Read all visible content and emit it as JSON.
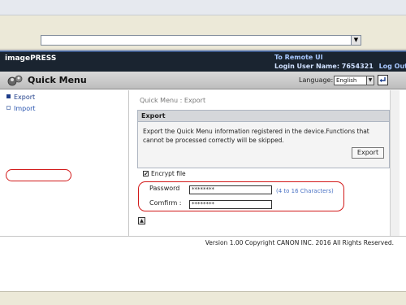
{
  "browser": {
    "address_value": ""
  },
  "header": {
    "brand": "imagePRESS",
    "remote_link": "To Remote UI",
    "login_prefix": "Login User Name: 7654321",
    "logout": "Log Out"
  },
  "titlebar": {
    "title": "Quick Menu",
    "language_label": "Language:",
    "language_value": "English"
  },
  "sidebar": {
    "items": [
      {
        "label": "Export",
        "state": "active"
      },
      {
        "label": "Import",
        "state": "inactive"
      }
    ]
  },
  "main": {
    "breadcrumb": "Quick Menu : Export",
    "export_panel": {
      "heading": "Export",
      "description": "Export the Quick Menu information registered in the device.Functions that cannot be processed correctly will be skipped.",
      "button_label": "Export"
    },
    "encrypt": {
      "checked": true,
      "check_mark": "✔",
      "label": "Encrypt file"
    },
    "password": {
      "label": "Password",
      "value": "********",
      "hint": "(4 to 16 Characters)"
    },
    "confirm": {
      "label": "Comfirm :",
      "value": "********"
    },
    "top_button_symbol": "▲"
  },
  "footer": {
    "copyright": "Version 1.00 Copyright CANON INC. 2016 All Rights Reserved."
  },
  "icons": {
    "address_dropdown": "▼",
    "language_dropdown": "▼"
  },
  "colors": {
    "header_bg": "#1a2430",
    "link_blue": "#a8c8ff",
    "annotation_red": "#d21a1a"
  }
}
